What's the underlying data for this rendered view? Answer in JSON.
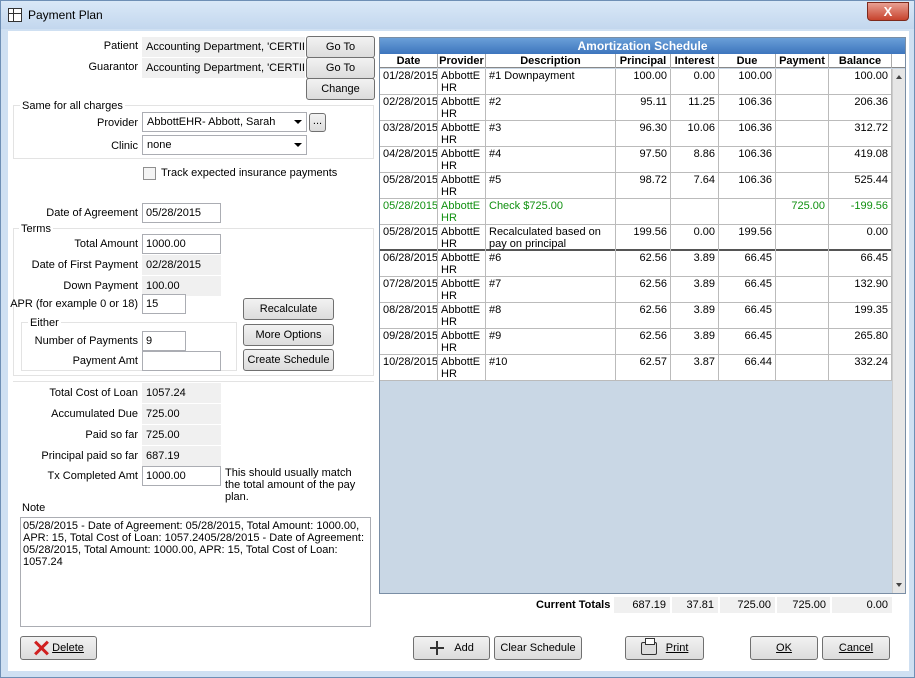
{
  "window": {
    "title": "Payment Plan",
    "close_glyph": "X"
  },
  "form": {
    "patient_label": "Patient",
    "patient_value": "Accounting Department, 'CERTIFICA",
    "guarantor_label": "Guarantor",
    "guarantor_value": "Accounting Department, 'CERTIFICA",
    "goto1": "Go To",
    "goto2": "Go To",
    "change": "Change",
    "same_group": "Same for all charges",
    "provider_label": "Provider",
    "provider_value": "AbbottEHR- Abbott, Sarah",
    "ellipsis": "...",
    "clinic_label": "Clinic",
    "clinic_value": "none",
    "track_label": "Track expected insurance payments",
    "agreement_label": "Date of Agreement",
    "agreement_value": "05/28/2015",
    "terms_group": "Terms",
    "total_amount_label": "Total Amount",
    "total_amount_value": "1000.00",
    "first_payment_label": "Date of First Payment",
    "first_payment_value": "02/28/2015",
    "down_payment_label": "Down Payment",
    "down_payment_value": "100.00",
    "apr_label": "APR (for example 0 or 18)",
    "apr_value": "15",
    "recalculate": "Recalculate",
    "either_group": "Either",
    "num_payments_label": "Number of Payments",
    "num_payments_value": "9",
    "more_options": "More Options",
    "payment_amt_label": "Payment Amt",
    "payment_amt_value": "",
    "create_schedule": "Create Schedule",
    "total_cost_label": "Total Cost of Loan",
    "total_cost_value": "1057.24",
    "accum_due_label": "Accumulated Due",
    "accum_due_value": "725.00",
    "paid_label": "Paid so far",
    "paid_value": "725.00",
    "principal_paid_label": "Principal paid so far",
    "principal_paid_value": "687.19",
    "tx_label": "Tx Completed Amt",
    "tx_value": "1000.00",
    "tx_hint": "This should usually match the total amount of the pay plan.",
    "note_label": "Note",
    "note_text": "05/28/2015 - Date of Agreement: 05/28/2015, Total Amount: 1000.00, APR: 15, Total Cost of Loan: 1057.2405/28/2015 - Date of Agreement: 05/28/2015, Total Amount: 1000.00, APR: 15, Total Cost of Loan: 1057.24"
  },
  "grid": {
    "title": "Amortization Schedule",
    "headers": [
      "Date",
      "Provider",
      "Description",
      "Principal",
      "Interest",
      "Due",
      "Payment",
      "Balance"
    ],
    "rows": [
      [
        "01/28/2015",
        "AbbottE HR",
        "#1 Downpayment",
        "100.00",
        "0.00",
        "100.00",
        "",
        "100.00"
      ],
      [
        "02/28/2015",
        "AbbottE HR",
        "#2",
        "95.11",
        "11.25",
        "106.36",
        "",
        "206.36"
      ],
      [
        "03/28/2015",
        "AbbottE HR",
        "#3",
        "96.30",
        "10.06",
        "106.36",
        "",
        "312.72"
      ],
      [
        "04/28/2015",
        "AbbottE HR",
        "#4",
        "97.50",
        "8.86",
        "106.36",
        "",
        "419.08"
      ],
      [
        "05/28/2015",
        "AbbottE HR",
        "#5",
        "98.72",
        "7.64",
        "106.36",
        "",
        "525.44"
      ],
      [
        "05/28/2015",
        "AbbottE HR",
        "Check $725.00",
        "",
        "",
        "",
        "725.00",
        "-199.56"
      ],
      [
        "05/28/2015",
        "AbbottE HR",
        "Recalculated based on pay on principal",
        "199.56",
        "0.00",
        "199.56",
        "",
        "0.00"
      ],
      [
        "06/28/2015",
        "AbbottE HR",
        "#6",
        "62.56",
        "3.89",
        "66.45",
        "",
        "66.45"
      ],
      [
        "07/28/2015",
        "AbbottE HR",
        "#7",
        "62.56",
        "3.89",
        "66.45",
        "",
        "132.90"
      ],
      [
        "08/28/2015",
        "AbbottE HR",
        "#8",
        "62.56",
        "3.89",
        "66.45",
        "",
        "199.35"
      ],
      [
        "09/28/2015",
        "AbbottE HR",
        "#9",
        "62.56",
        "3.89",
        "66.45",
        "",
        "265.80"
      ],
      [
        "10/28/2015",
        "AbbottE HR",
        "#10",
        "62.57",
        "3.87",
        "66.44",
        "",
        "332.24"
      ]
    ],
    "totals_label": "Current Totals",
    "totals": [
      "687.19",
      "37.81",
      "725.00",
      "725.00",
      "0.00"
    ],
    "payment_row_color": "#109010"
  },
  "buttons": {
    "delete": "Delete",
    "add": "Add",
    "clear": "Clear Schedule",
    "print": "Print",
    "ok": "OK",
    "cancel": "Cancel"
  }
}
